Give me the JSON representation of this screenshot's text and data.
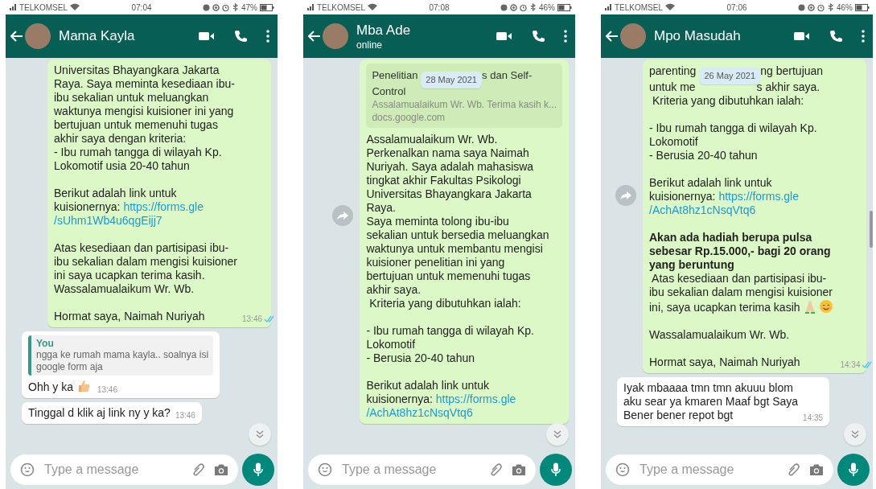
{
  "phones": [
    {
      "status_bar": {
        "carrier": "TELKOMSEL",
        "time": "07:04",
        "battery": "47%"
      },
      "header": {
        "name": "Mama Kayla"
      },
      "messages": [
        {
          "kind": "outgoing",
          "forwarded": false,
          "parts": [
            {
              "kind": "text",
              "text": "Universitas Bhayangkara Jakarta\nRaya. Saya meminta kesediaan ibu-\nibu sekalian untuk meluangkan\nwaktunya mengisi kuisioner ini yang\nbertujuan untuk memenuhi tugas\nakhir saya dengan kriteria:\n- Ibu rumah tangga di wilayah Kp.\nLokomotif usia 20-40 tahun\n\nBerikut adalah link untuk\nkuisionernya: "
            },
            {
              "kind": "link",
              "text": "https://forms.gle"
            },
            {
              "kind": "break"
            },
            {
              "kind": "link",
              "text": "/sUhm1Wb4u6qgEijj7"
            },
            {
              "kind": "text",
              "text": "\n\nAtas kesediaan dan partisipasi ibu-\nibu sekalian dalam mengisi kuisioner\nini saya ucapkan terima kasih.\nWassalamualaikum Wr. Wb.\n\nHormat saya, Naimah Nuriyah"
            }
          ],
          "time": "13:46",
          "read": true
        },
        {
          "kind": "incoming",
          "forwarded": false,
          "quote": {
            "author": "You",
            "text": "ngga ke rumah mama kayla.. soalnya isi\ngoogle form aja"
          },
          "parts": [
            {
              "kind": "text",
              "text": "Ohh y ka "
            },
            {
              "kind": "thumbsup"
            }
          ],
          "time": "13:46"
        },
        {
          "kind": "incoming",
          "forwarded": false,
          "parts": [
            {
              "kind": "text",
              "text": "Tinggal d klik aj link ny y ka?"
            }
          ],
          "time": "13:46"
        }
      ],
      "scrollbar_visible": false,
      "input": {
        "placeholder": "Type a message"
      }
    },
    {
      "status_bar": {
        "carrier": "TELKOMSEL",
        "time": "07:08",
        "battery": "46%"
      },
      "header": {
        "name": "Mba Ade",
        "subtitle": "online"
      },
      "messages": [
        {
          "kind": "outgoing",
          "forwarded": true,
          "preview": {
            "title_parts": [
              {
                "kind": "text",
                "text": "Penelitian "
              },
              {
                "kind": "date",
                "text": "28 May 2021"
              },
              {
                "kind": "text",
                "text": "s dan Self-\nControl"
              }
            ],
            "description": "Assalamualaikum Wr. Wb. Terima kasih k...",
            "domain": "docs.google.com"
          },
          "parts": [
            {
              "kind": "text",
              "text": "Assalamualaikum Wr. Wb.\nPerkenalkan nama saya Naimah\nNuriyah. Saya adalah mahasiswa\ntingkat akhir Fakultas Psikologi\nUniversitas Bhayangkara Jakarta\nRaya.\nSaya meminta tolong ibu-ibu\nsekalian untuk bersedia meluangkan\nwaktunya untuk membantu mengisi\nkuisioner penelitian ini yang\nbertujuan untuk memenuhi tugas\nakhir saya.\n Kriteria yang dibutuhkan ialah:\n\n- Ibu rumah tangga di wilayah Kp.\nLokomotif\n- Berusia 20-40 tahun\n\nBerikut adalah link untuk\nkuisionernya: "
            },
            {
              "kind": "link",
              "text": "https://forms.gle"
            },
            {
              "kind": "break"
            },
            {
              "kind": "link",
              "text": "/AchAt8hz1cNsqVtq6"
            }
          ]
        }
      ],
      "scrollbar_visible": false,
      "input": {
        "placeholder": "Type a message"
      }
    },
    {
      "status_bar": {
        "carrier": "TELKOMSEL",
        "time": "07:06",
        "battery": "46%"
      },
      "header": {
        "name": "Mpo Masudah"
      },
      "messages": [
        {
          "kind": "outgoing",
          "forwarded": true,
          "parts": [
            {
              "kind": "text",
              "text": "parenting "
            },
            {
              "kind": "date",
              "text": "26 May 2021"
            },
            {
              "kind": "text",
              "text": "ng bertujuan\nuntuk me"
            },
            {
              "kind": "gap"
            },
            {
              "kind": "text",
              "text": "s akhir saya.\n Kriteria yang dibutuhkan ialah:\n\n- Ibu rumah tangga di wilayah Kp.\nLokomotif\n- Berusia 20-40 tahun\n\nBerikut adalah link untuk\nkuisionernya: "
            },
            {
              "kind": "link",
              "text": "https://forms.gle"
            },
            {
              "kind": "break"
            },
            {
              "kind": "link",
              "text": "/AchAt8hz1cNsqVtq6"
            },
            {
              "kind": "break"
            },
            {
              "kind": "break"
            },
            {
              "kind": "bold",
              "text": "Akan ada hadiah berupa pulsa\nsebesar Rp.15.000,- bagi 20 orang\nyang beruntung"
            },
            {
              "kind": "text",
              "text": "\n Atas kesediaan dan partisipasi ibu-\nibu sekalian dalam mengisi kuisioner\nini, saya ucapkan terima kasih "
            },
            {
              "kind": "pray"
            },
            {
              "kind": "smile"
            },
            {
              "kind": "text",
              "text": "\n\nWassalamualaikum Wr. Wb.\n\nHormat saya, Naimah Nuriyah"
            }
          ],
          "time": "14:34",
          "read": true
        },
        {
          "kind": "incoming",
          "forwarded": false,
          "parts": [
            {
              "kind": "text",
              "text": "Iyak mbaaaa tmn tmn akuuu blom\naku sear ya kmaren Maaf bgt Saya\nBener bener repot bgt"
            }
          ],
          "time": "14:35"
        }
      ],
      "scrollbar_visible": true,
      "input": {
        "placeholder": "Type a message"
      }
    }
  ]
}
